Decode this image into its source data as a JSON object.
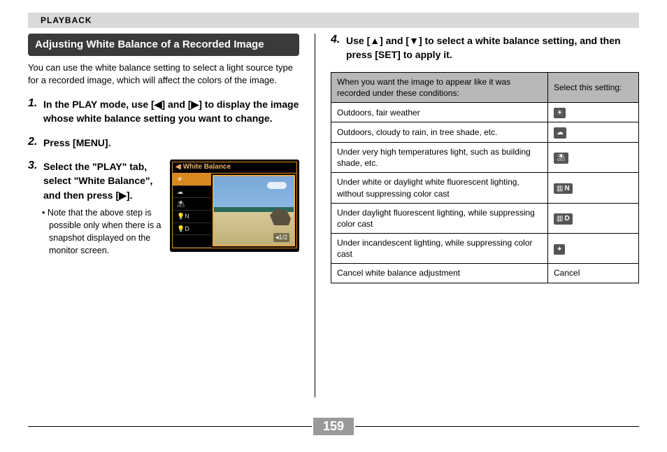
{
  "header": {
    "section": "PLAYBACK"
  },
  "page_number": "159",
  "left": {
    "title": "Adjusting White Balance of a Recorded Image",
    "intro": "You can use the white balance setting to select a light source type for a recorded image, which will affect the colors of the image.",
    "steps": [
      {
        "num": "1.",
        "text": "In the PLAY mode, use [◀] and [▶] to display the image whose white balance setting you want to change."
      },
      {
        "num": "2.",
        "text": "Press [MENU]."
      },
      {
        "num": "3.",
        "text": "Select the \"PLAY\" tab, select \"White Balance\", and then press [▶].",
        "note": "Note that the above step is possible only when there is a snapshot displayed on the monitor screen."
      }
    ],
    "lcd": {
      "title": "White Balance",
      "menu": [
        {
          "icon": "☀",
          "sel": true
        },
        {
          "icon": "☁"
        },
        {
          "icon": "⛱"
        },
        {
          "icon": "💡",
          "suffix": "N"
        },
        {
          "icon": "💡",
          "suffix": "D"
        },
        {
          "icon": " "
        }
      ],
      "page_indicator": "1/2"
    }
  },
  "right": {
    "step4": {
      "num": "4.",
      "text": "Use [▲] and [▼] to select a white balance setting, and then press [SET] to apply it."
    },
    "table": {
      "head_condition": "When you want the image to appear like it was recorded under these conditions:",
      "head_setting": "Select this setting:",
      "rows": [
        {
          "cond": "Outdoors, fair weather",
          "icon": "☀",
          "suffix": ""
        },
        {
          "cond": "Outdoors, cloudy to rain, in tree shade, etc.",
          "icon": "☁",
          "suffix": ""
        },
        {
          "cond": "Under very high temperatures light, such as building shade, etc.",
          "icon": "⛱",
          "suffix": ""
        },
        {
          "cond": "Under white or daylight white fluorescent lighting, without suppressing color cast",
          "icon": "▥",
          "suffix": "N"
        },
        {
          "cond": "Under daylight fluorescent lighting, while suppressing color cast",
          "icon": "▥",
          "suffix": "D"
        },
        {
          "cond": "Under incandescent lighting, while suppressing color cast",
          "icon": "✦",
          "suffix": ""
        },
        {
          "cond": "Cancel white balance adjustment",
          "text": "Cancel"
        }
      ]
    }
  }
}
